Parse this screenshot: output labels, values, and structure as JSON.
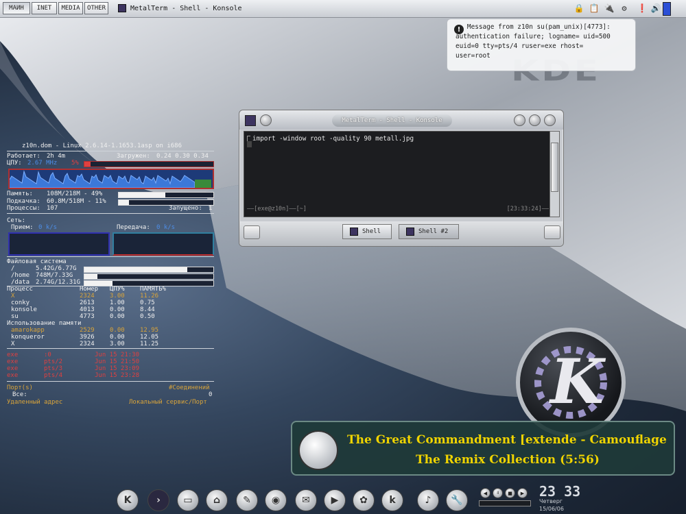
{
  "topbar": {
    "tabs": [
      "МАИН",
      "INET",
      "MEDIA",
      "OTHER"
    ],
    "window_title": "MetalTerm - Shell - Konsole"
  },
  "notification": {
    "lines": [
      "   Message from z10n su(pam_unix)[4773]:",
      "authentication failure; logname= uid=500",
      "euid=0 tty=pts/4 ruser=exe rhost=",
      "user=root"
    ]
  },
  "wallpaper": {
    "watermark": "KDE"
  },
  "konsole": {
    "title": "MetalTerm - Shell - Konsole",
    "command": "import -window root -quality 90 metall.jpg",
    "status_left": "——[exe@z10n]——[~]",
    "status_right": "[23:33:24]——",
    "tabs": [
      "Shell",
      "Shell #2"
    ]
  },
  "conky": {
    "header": "z10n.dom - Linux 2.6.14-1.1653.1asp on i686",
    "uptime_label": "Работает:",
    "uptime": "2h 4m",
    "load_label": "Загружен:",
    "load": "0.24 0.30 0.34",
    "cpu_label": "ЦПУ:",
    "cpu_freq": "2.67 MHz",
    "cpu_pct": "5%",
    "cpu_usage": 0.05,
    "mem_label": "Память:",
    "mem": "108M/218M - 49%",
    "mem_usage": 0.49,
    "swap_label": "Подкачка:",
    "swap": "60.8M/518M - 11%",
    "swap_usage": 0.11,
    "procs_label": "Процессы:",
    "procs": "107",
    "running_label": "Запущено:",
    "running": "1",
    "net_label": "Сеть:",
    "down_label": "Прием:",
    "down": "0 k/s",
    "up_label": "Передача:",
    "up": "0 k/s",
    "fs_label": "Файловая система",
    "fs": [
      {
        "mount": "/",
        "size": "5.42G/6.77G",
        "usage": 0.8
      },
      {
        "mount": "/home",
        "size": "748M/7.33G",
        "usage": 0.1
      },
      {
        "mount": "/data",
        "size": "2.74G/12.31G",
        "usage": 0.22
      }
    ],
    "proc_headers": [
      "Процесс",
      "Номер",
      "ЦПУ%",
      "ПАМЯТЬ%"
    ],
    "cpu_procs": [
      [
        "X",
        "2324",
        "3.00",
        "11.26"
      ],
      [
        "conky",
        "2613",
        "1.00",
        "0.75"
      ],
      [
        "konsole",
        "4013",
        "0.00",
        "8.44"
      ],
      [
        "su",
        "4773",
        "0.00",
        "0.50"
      ]
    ],
    "mem_title": "Использование памяти",
    "mem_procs": [
      [
        "amarokapp",
        "2529",
        "0.00",
        "12.95"
      ],
      [
        "konqueror",
        "3926",
        "0.00",
        "12.05"
      ],
      [
        "X",
        "2324",
        "3.00",
        "11.25"
      ]
    ],
    "logins": [
      [
        "exe",
        ":0",
        "Jun 15 21:30"
      ],
      [
        "exe",
        "pts/2",
        "Jun 15 21:50"
      ],
      [
        "exe",
        "pts/3",
        "Jun 15 23:09"
      ],
      [
        "exe",
        "pts/4",
        "Jun 15 23:28"
      ]
    ],
    "port_label": "Порт(s)",
    "conn_label": "#Соединений",
    "all_label": "Все:",
    "all_value": "0",
    "remote_label": "Удаленный адрес",
    "local_label": "Локальный сервис/Порт"
  },
  "now_playing": {
    "line1": "The Great Commandment [extende - Camouflage",
    "line2": "The Remix Collection (5:56)"
  },
  "clock": {
    "time": "23 33",
    "day": "Четверг",
    "date": "15/06/06"
  },
  "colors": {
    "accent": "#f0d400",
    "cpu_graph": "#1d3a78",
    "highlight": "#d9a43a",
    "alert": "#e04040"
  }
}
